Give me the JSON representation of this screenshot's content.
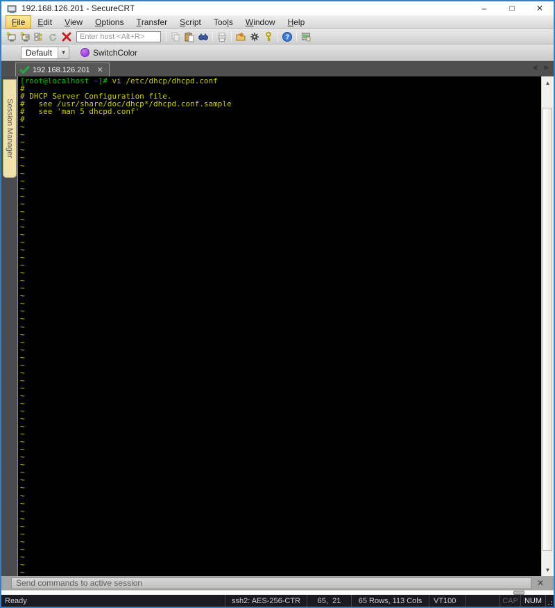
{
  "window": {
    "title": "192.168.126.201 - SecureCRT",
    "controls": {
      "minimize": "–",
      "maximize": "□",
      "close": "✕"
    }
  },
  "menu": {
    "items": [
      {
        "label": "File",
        "mnemonic_index": 0,
        "active": true
      },
      {
        "label": "Edit",
        "mnemonic_index": 0,
        "active": false
      },
      {
        "label": "View",
        "mnemonic_index": 0,
        "active": false
      },
      {
        "label": "Options",
        "mnemonic_index": 0,
        "active": false
      },
      {
        "label": "Transfer",
        "mnemonic_index": 0,
        "active": false
      },
      {
        "label": "Script",
        "mnemonic_index": 0,
        "active": false
      },
      {
        "label": "Tools",
        "mnemonic_index": 3,
        "active": false
      },
      {
        "label": "Window",
        "mnemonic_index": 0,
        "active": false
      },
      {
        "label": "Help",
        "mnemonic_index": 0,
        "active": false
      }
    ]
  },
  "toolbar": {
    "host_input": {
      "value": "",
      "placeholder": "Enter host <Alt+R>"
    },
    "icons": [
      "quick-connect",
      "connect",
      "connect-in-tab",
      "reconnect",
      "disconnect",
      "copy",
      "paste",
      "find",
      "print",
      "session-options",
      "global-options",
      "manage-agent-keys",
      "help",
      "session-manager-toggle"
    ]
  },
  "toolbar2": {
    "combo_value": "Default",
    "switchcolor_label": "SwitchColor"
  },
  "session_manager": {
    "label": "Session Manager"
  },
  "tab": {
    "label": "192.168.126.201",
    "close_glyph": "✕",
    "check_icon": "green-checkmark"
  },
  "terminal": {
    "colors": {
      "green": "#00c300",
      "yellow": "#cdcd00",
      "blue": "#3c3cc8",
      "background": "#000000"
    },
    "prompt_segments": [
      {
        "text": "[root@localhost ",
        "color": "green"
      },
      {
        "text": "~",
        "color": "blue"
      },
      {
        "text": "]# ",
        "color": "green"
      },
      {
        "text": "vi /etc/dhcp/dhcpd.conf",
        "color": "yellow"
      }
    ],
    "comment_lines": [
      "#",
      "# DHCP Server Configuration file.",
      "#   see /usr/share/doc/dhcp*/dhcpd.conf.sample",
      "#   see 'man 5 dhcpd.conf'",
      "#"
    ],
    "tilde_char": "~",
    "tilde_rows": 59
  },
  "command_bar": {
    "value": "",
    "placeholder": "Send commands to active session",
    "close_glyph": "✕"
  },
  "status_bar": {
    "ready": "Ready",
    "cipher": "ssh2: AES-256-CTR",
    "cursor_position": "65,  21",
    "terminal_size": "65 Rows, 113 Cols",
    "emulation": "VT100",
    "caps_lock": "CAP",
    "num_lock": "NUM"
  }
}
